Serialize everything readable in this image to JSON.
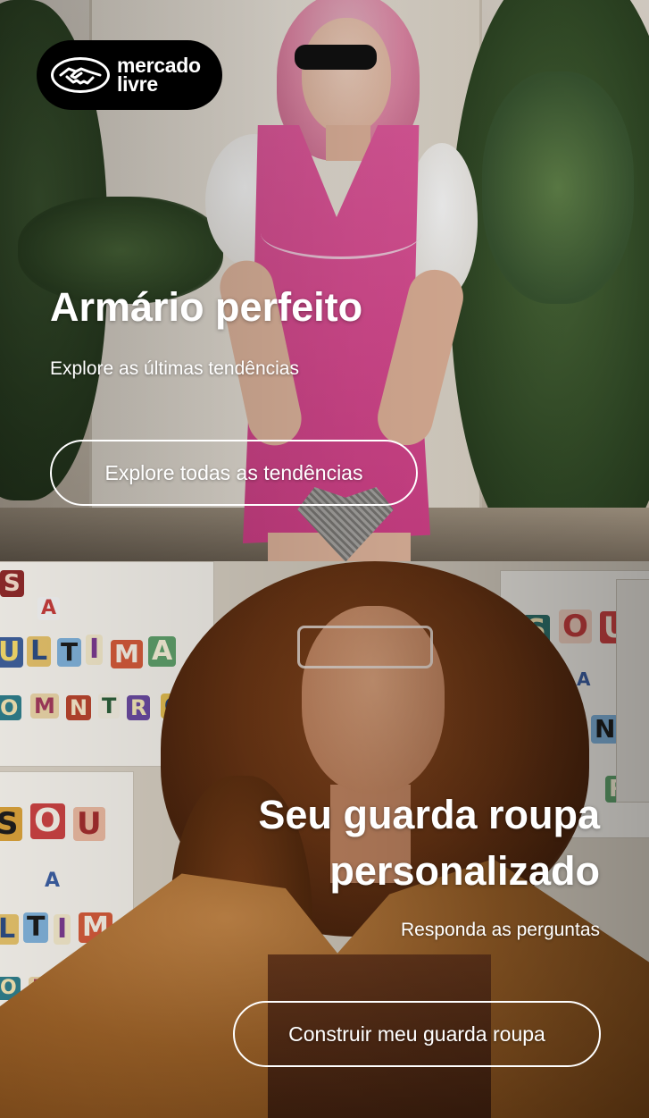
{
  "brand": {
    "line1": "mercado",
    "line2": "livre",
    "logo_bg": "#000000",
    "logo_icon": "handshake-icon"
  },
  "cards": [
    {
      "title": "Armário perfeito",
      "subtitle": "Explore as últimas tendências",
      "button_label": "Explore todas as tendências",
      "image": "woman-pink-dress-photo"
    },
    {
      "title_line1": "Seu guarda roupa",
      "title_line2": "personalizado",
      "subtitle": "Responda as perguntas",
      "button_label": "Construir meu guarda roupa",
      "image": "woman-curly-hair-photo"
    }
  ],
  "poster_cuts": {
    "a": "A",
    "u": "U",
    "l": "L",
    "t": "T",
    "i": "I",
    "m": "M",
    "s": "S",
    "o": "O",
    "r": "R",
    "n": "N"
  },
  "colors": {
    "button_border": "#ffffff",
    "text": "#ffffff"
  }
}
